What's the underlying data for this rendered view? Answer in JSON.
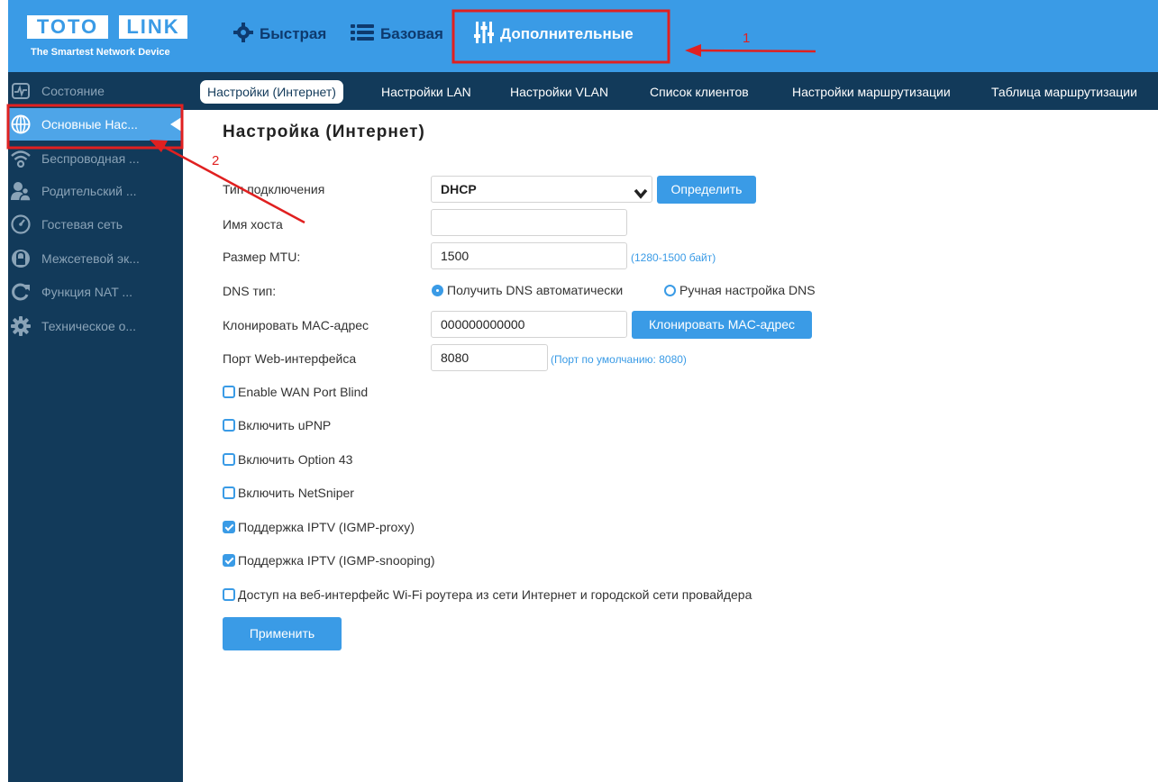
{
  "header": {
    "logo_word1": "TOTO",
    "logo_word2": "LINK",
    "logo_tagline": "The Smartest Network Device",
    "modes": [
      {
        "label": "Быстрая",
        "icon": "gear-icon"
      },
      {
        "label": "Базовая",
        "icon": "list-icon"
      },
      {
        "label": "Дополнительные",
        "icon": "sliders-icon"
      }
    ]
  },
  "sidebar": {
    "items": [
      {
        "label": "Состояние",
        "icon": "pulse-icon"
      },
      {
        "label": "Основные Нас...",
        "icon": "globe-icon"
      },
      {
        "label": "Беспроводная ...",
        "icon": "wifi-icon"
      },
      {
        "label": "Родительский ...",
        "icon": "parental-icon"
      },
      {
        "label": "Гостевая сеть",
        "icon": "gauge-icon"
      },
      {
        "label": "Межсетевой эк...",
        "icon": "lock-icon"
      },
      {
        "label": "Функция NAT ...",
        "icon": "refresh-icon"
      },
      {
        "label": "Техническое о...",
        "icon": "gear-icon"
      }
    ]
  },
  "tabs": [
    {
      "label": "Настройки (Интернет)"
    },
    {
      "label": "Настройки LAN"
    },
    {
      "label": "Настройки VLAN"
    },
    {
      "label": "Список клиентов"
    },
    {
      "label": "Настройки маршрутизации"
    },
    {
      "label": "Таблица маршрутизации"
    }
  ],
  "form": {
    "title": "Настройка (Интернет)",
    "conn_type_label": "Тип подключения",
    "conn_type_value": "DHCP",
    "detect_button": "Определить",
    "hostname_label": "Имя хоста",
    "hostname_value": "",
    "mtu_label": "Размер MTU:",
    "mtu_value": "1500",
    "mtu_hint": "(1280-1500 байт)",
    "dns_label": "DNS тип:",
    "dns_auto": "Получить DNS автоматически",
    "dns_manual": "Ручная настройка DNS",
    "mac_label": "Клонировать MAC-адрес",
    "mac_value": "000000000000",
    "mac_button": "Клонировать MAC-адрес",
    "port_label": "Порт Web-интерфейса",
    "port_value": "8080",
    "port_hint": "(Порт по умолчанию: 8080)",
    "checkboxes": [
      {
        "label": "Enable WAN Port Blind",
        "checked": false
      },
      {
        "label": "Включить uPNP",
        "checked": false
      },
      {
        "label": "Включить Option 43",
        "checked": false
      },
      {
        "label": "Включить NetSniper",
        "checked": false
      },
      {
        "label": "Поддержка IPTV (IGMP-proxy)",
        "checked": true
      },
      {
        "label": "Поддержка IPTV (IGMP-snooping)",
        "checked": true
      },
      {
        "label": "Доступ на веб-интерфейс Wi-Fi роутера из сети Интернет и городской сети провайдера",
        "checked": false
      }
    ],
    "apply_button": "Применить"
  },
  "annotations": {
    "marker1": "1",
    "marker2": "2",
    "color": "#e02020"
  },
  "colors": {
    "accent": "#3a9be6",
    "sidebar": "#123a5a",
    "header_text": "#0e3a6e"
  }
}
